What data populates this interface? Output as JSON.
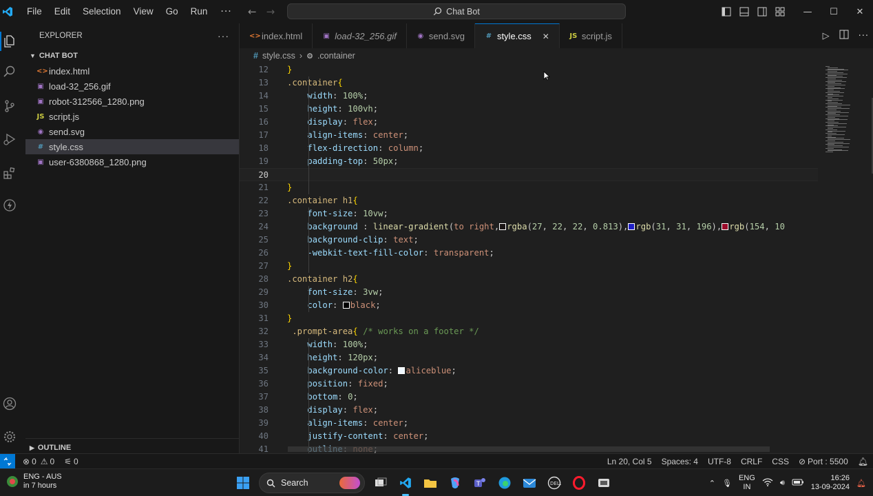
{
  "titlebar": {
    "menu": [
      "File",
      "Edit",
      "Selection",
      "View",
      "Go",
      "Run"
    ],
    "more": "···",
    "search_text": "Chat Bot"
  },
  "sidebar": {
    "title": "EXPLORER",
    "more": "···",
    "folder": "CHAT BOT",
    "files": [
      {
        "name": "index.html",
        "icon": "html-file-icon",
        "glyph": "<>",
        "color": "#e37933"
      },
      {
        "name": "load-32_256.gif",
        "icon": "image-file-icon",
        "glyph": "▣",
        "color": "#a074c4"
      },
      {
        "name": "robot-312566_1280.png",
        "icon": "image-file-icon",
        "glyph": "▣",
        "color": "#a074c4"
      },
      {
        "name": "script.js",
        "icon": "js-file-icon",
        "glyph": "JS",
        "color": "#cbcb41"
      },
      {
        "name": "send.svg",
        "icon": "svg-file-icon",
        "glyph": "◉",
        "color": "#a074c4"
      },
      {
        "name": "style.css",
        "icon": "css-file-icon",
        "glyph": "#",
        "color": "#519aba"
      },
      {
        "name": "user-6380868_1280.png",
        "icon": "image-file-icon",
        "glyph": "▣",
        "color": "#a074c4"
      }
    ],
    "outline": "OUTLINE"
  },
  "tabs": [
    {
      "label": "index.html",
      "glyph": "<>",
      "color": "#e37933",
      "italic": false
    },
    {
      "label": "load-32_256.gif",
      "glyph": "▣",
      "color": "#a074c4",
      "italic": true
    },
    {
      "label": "send.svg",
      "glyph": "◉",
      "color": "#a074c4",
      "italic": false
    },
    {
      "label": "style.css",
      "glyph": "#",
      "color": "#519aba",
      "italic": false
    },
    {
      "label": "script.js",
      "glyph": "JS",
      "color": "#cbcb41",
      "italic": false
    }
  ],
  "breadcrumb": {
    "file": "style.css",
    "symbol": ".container"
  },
  "editor": {
    "current_line": 20,
    "lines": [
      {
        "n": 12,
        "tokens": [
          [
            "brace",
            "}"
          ]
        ]
      },
      {
        "n": 13,
        "tokens": [
          [
            "sel",
            ".container"
          ],
          [
            "brace",
            "{"
          ]
        ]
      },
      {
        "n": 14,
        "tokens": [
          [
            "sp",
            "    "
          ],
          [
            "prop",
            "width"
          ],
          [
            "pl",
            ": "
          ],
          [
            "num",
            "100%"
          ],
          [
            "pl",
            ";"
          ]
        ]
      },
      {
        "n": 15,
        "tokens": [
          [
            "sp",
            "    "
          ],
          [
            "prop",
            "height"
          ],
          [
            "pl",
            ": "
          ],
          [
            "num",
            "100vh"
          ],
          [
            "pl",
            ";"
          ]
        ]
      },
      {
        "n": 16,
        "tokens": [
          [
            "sp",
            "    "
          ],
          [
            "prop",
            "display"
          ],
          [
            "pl",
            ": "
          ],
          [
            "val",
            "flex"
          ],
          [
            "pl",
            ";"
          ]
        ]
      },
      {
        "n": 17,
        "tokens": [
          [
            "sp",
            "    "
          ],
          [
            "prop",
            "align-items"
          ],
          [
            "pl",
            ": "
          ],
          [
            "val",
            "center"
          ],
          [
            "pl",
            ";"
          ]
        ]
      },
      {
        "n": 18,
        "tokens": [
          [
            "sp",
            "    "
          ],
          [
            "prop",
            "flex-direction"
          ],
          [
            "pl",
            ": "
          ],
          [
            "val",
            "column"
          ],
          [
            "pl",
            ";"
          ]
        ]
      },
      {
        "n": 19,
        "tokens": [
          [
            "sp",
            "    "
          ],
          [
            "prop",
            "padding-top"
          ],
          [
            "pl",
            ": "
          ],
          [
            "num",
            "50px"
          ],
          [
            "pl",
            ";"
          ]
        ]
      },
      {
        "n": 20,
        "tokens": []
      },
      {
        "n": 21,
        "tokens": [
          [
            "brace",
            "}"
          ]
        ]
      },
      {
        "n": 22,
        "tokens": [
          [
            "sel",
            ".container h1"
          ],
          [
            "brace",
            "{"
          ]
        ]
      },
      {
        "n": 23,
        "tokens": [
          [
            "sp",
            "    "
          ],
          [
            "prop",
            "font-size"
          ],
          [
            "pl",
            ": "
          ],
          [
            "num",
            "10vw"
          ],
          [
            "pl",
            ";"
          ]
        ]
      },
      {
        "n": 24,
        "tokens": [
          [
            "sp",
            "    "
          ],
          [
            "prop",
            "background"
          ],
          [
            "pl",
            " : "
          ],
          [
            "fn",
            "linear-gradient"
          ],
          [
            "pl",
            "("
          ],
          [
            "val",
            "to right"
          ],
          [
            "pl",
            ","
          ],
          [
            "sw",
            "#1b1616"
          ],
          [
            "fn",
            "rgba"
          ],
          [
            "pl",
            "("
          ],
          [
            "num",
            "27"
          ],
          [
            "pl",
            ", "
          ],
          [
            "num",
            "22"
          ],
          [
            "pl",
            ", "
          ],
          [
            "num",
            "22"
          ],
          [
            "pl",
            ", "
          ],
          [
            "num",
            "0.813"
          ],
          [
            "pl",
            "),"
          ],
          [
            "sw",
            "#1f1fc4"
          ],
          [
            "fn",
            "rgb"
          ],
          [
            "pl",
            "("
          ],
          [
            "num",
            "31"
          ],
          [
            "pl",
            ", "
          ],
          [
            "num",
            "31"
          ],
          [
            "pl",
            ", "
          ],
          [
            "num",
            "196"
          ],
          [
            "pl",
            "),"
          ],
          [
            "sw",
            "#9a0a2a"
          ],
          [
            "fn",
            "rgb"
          ],
          [
            "pl",
            "("
          ],
          [
            "num",
            "154"
          ],
          [
            "pl",
            ", "
          ],
          [
            "num",
            "10"
          ]
        ]
      },
      {
        "n": 25,
        "tokens": [
          [
            "sp",
            "    "
          ],
          [
            "prop",
            "background-clip"
          ],
          [
            "pl",
            ": "
          ],
          [
            "val",
            "text"
          ],
          [
            "pl",
            ";"
          ]
        ]
      },
      {
        "n": 26,
        "tokens": [
          [
            "sp",
            "    "
          ],
          [
            "prop",
            "-webkit-text-fill-color"
          ],
          [
            "pl",
            ": "
          ],
          [
            "val",
            "transparent"
          ],
          [
            "pl",
            ";"
          ]
        ]
      },
      {
        "n": 27,
        "tokens": [
          [
            "brace",
            "}"
          ]
        ]
      },
      {
        "n": 28,
        "tokens": [
          [
            "sel",
            ".container h2"
          ],
          [
            "brace",
            "{"
          ]
        ]
      },
      {
        "n": 29,
        "tokens": [
          [
            "sp",
            "    "
          ],
          [
            "prop",
            "font-size"
          ],
          [
            "pl",
            ": "
          ],
          [
            "num",
            "3vw"
          ],
          [
            "pl",
            ";"
          ]
        ]
      },
      {
        "n": 30,
        "tokens": [
          [
            "sp",
            "    "
          ],
          [
            "prop",
            "color"
          ],
          [
            "pl",
            ": "
          ],
          [
            "sw",
            "#000000"
          ],
          [
            "val",
            "black"
          ],
          [
            "pl",
            ";"
          ]
        ]
      },
      {
        "n": 31,
        "tokens": [
          [
            "brace",
            "}"
          ]
        ]
      },
      {
        "n": 32,
        "tokens": [
          [
            "pl",
            " "
          ],
          [
            "sel",
            ".prompt-area"
          ],
          [
            "brace",
            "{"
          ],
          [
            "pl",
            " "
          ],
          [
            "cmt",
            "/* works on a footer */"
          ]
        ]
      },
      {
        "n": 33,
        "tokens": [
          [
            "sp",
            "    "
          ],
          [
            "prop",
            "width"
          ],
          [
            "pl",
            ": "
          ],
          [
            "num",
            "100%"
          ],
          [
            "pl",
            ";"
          ]
        ]
      },
      {
        "n": 34,
        "tokens": [
          [
            "sp",
            "    "
          ],
          [
            "prop",
            "height"
          ],
          [
            "pl",
            ": "
          ],
          [
            "num",
            "120px"
          ],
          [
            "pl",
            ";"
          ]
        ]
      },
      {
        "n": 35,
        "tokens": [
          [
            "sp",
            "    "
          ],
          [
            "prop",
            "background-color"
          ],
          [
            "pl",
            ": "
          ],
          [
            "sw",
            "#f0f8ff"
          ],
          [
            "val",
            "aliceblue"
          ],
          [
            "pl",
            ";"
          ]
        ]
      },
      {
        "n": 36,
        "tokens": [
          [
            "sp",
            "    "
          ],
          [
            "prop",
            "position"
          ],
          [
            "pl",
            ": "
          ],
          [
            "val",
            "fixed"
          ],
          [
            "pl",
            ";"
          ]
        ]
      },
      {
        "n": 37,
        "tokens": [
          [
            "sp",
            "    "
          ],
          [
            "prop",
            "bottom"
          ],
          [
            "pl",
            ": "
          ],
          [
            "num",
            "0"
          ],
          [
            "pl",
            ";"
          ]
        ]
      },
      {
        "n": 38,
        "tokens": [
          [
            "sp",
            "    "
          ],
          [
            "prop",
            "display"
          ],
          [
            "pl",
            ": "
          ],
          [
            "val",
            "flex"
          ],
          [
            "pl",
            ";"
          ]
        ]
      },
      {
        "n": 39,
        "tokens": [
          [
            "sp",
            "    "
          ],
          [
            "prop",
            "align-items"
          ],
          [
            "pl",
            ": "
          ],
          [
            "val",
            "center"
          ],
          [
            "pl",
            ";"
          ]
        ]
      },
      {
        "n": 40,
        "tokens": [
          [
            "sp",
            "    "
          ],
          [
            "prop",
            "justify-content"
          ],
          [
            "pl",
            ": "
          ],
          [
            "val",
            "center"
          ],
          [
            "pl",
            ";"
          ]
        ]
      },
      {
        "n": 41,
        "tokens": [
          [
            "sp",
            "    "
          ],
          [
            "prop",
            "outline"
          ],
          [
            "pl",
            ": "
          ],
          [
            "val",
            "none"
          ],
          [
            "pl",
            ";"
          ]
        ]
      }
    ]
  },
  "statusbar": {
    "errors": "0",
    "warnings": "0",
    "ports": "0",
    "position": "Ln 20, Col 5",
    "spaces": "Spaces: 4",
    "encoding": "UTF-8",
    "eol": "CRLF",
    "language": "CSS",
    "port": "Port : 5500"
  },
  "taskbar": {
    "weather_line1": "ENG - AUS",
    "weather_line2": "in 7 hours",
    "search": "Search",
    "lang1": "ENG",
    "lang2": "IN",
    "time": "16:26",
    "date": "13-09-2024"
  }
}
